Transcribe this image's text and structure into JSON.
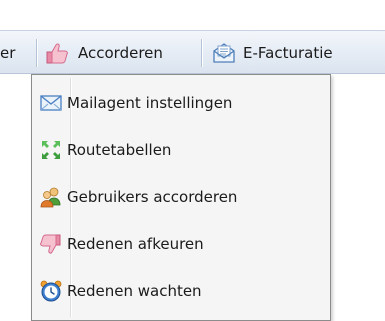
{
  "toolbar": {
    "partial_label": "er",
    "accorderen_label": "Accorderen",
    "efacturatie_label": "E-Facturatie"
  },
  "menu": {
    "items": [
      {
        "label": "Mailagent instellingen",
        "icon": "envelope-icon"
      },
      {
        "label": "Routetabellen",
        "icon": "arrows-expand-icon"
      },
      {
        "label": "Gebruikers accorderen",
        "icon": "users-icon"
      },
      {
        "label": "Redenen afkeuren",
        "icon": "thumbs-down-icon"
      },
      {
        "label": "Redenen wachten",
        "icon": "alarm-clock-icon"
      }
    ]
  },
  "colors": {
    "toolbar_top": "#f3f6fa",
    "toolbar_bottom": "#dbe4ef",
    "menu_bg": "#f5f5f5",
    "menu_border": "#8c8c8c"
  }
}
